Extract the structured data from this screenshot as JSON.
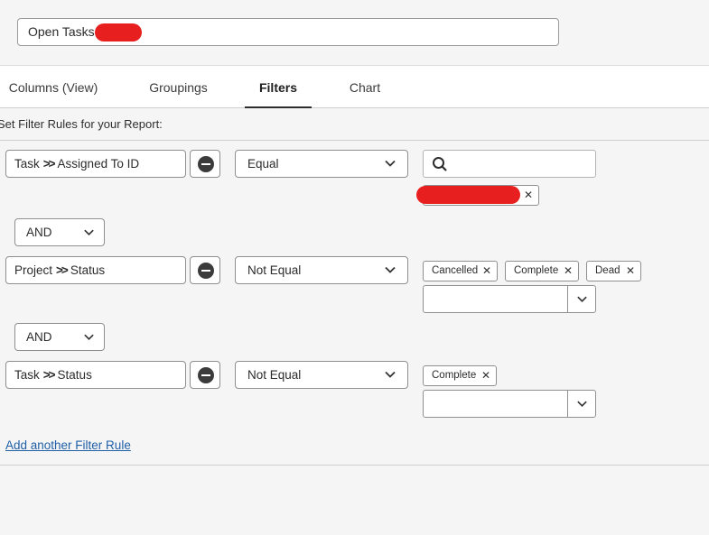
{
  "report_name": {
    "value": "Open Tasks -"
  },
  "tabs": [
    {
      "label": "Columns (View)"
    },
    {
      "label": "Groupings"
    },
    {
      "label": "Filters",
      "active": true
    },
    {
      "label": "Chart"
    }
  ],
  "section_title": "Set Filter Rules for your Report:",
  "rules": [
    {
      "field_object": "Task",
      "field_name": "Assigned To ID",
      "operator": "Equal",
      "value_tags": []
    },
    {
      "field_object": "Project",
      "field_name": "Status",
      "operator": "Not Equal",
      "value_tags": [
        "Cancelled",
        "Complete",
        "Dead"
      ]
    },
    {
      "field_object": "Task",
      "field_name": "Status",
      "operator": "Not Equal",
      "value_tags": [
        "Complete"
      ]
    }
  ],
  "connectors": [
    "AND",
    "AND"
  ],
  "add_rule_link": "Add another Filter Rule",
  "icons": {
    "remove": "minus-circle-icon",
    "dropdown": "chevron-down-icon",
    "search": "search-icon",
    "tag_remove": "close-icon",
    "separator": "double-chevron-right-icon"
  },
  "colors": {
    "link": "#1f5fa8",
    "redaction": "#e81f1f"
  }
}
